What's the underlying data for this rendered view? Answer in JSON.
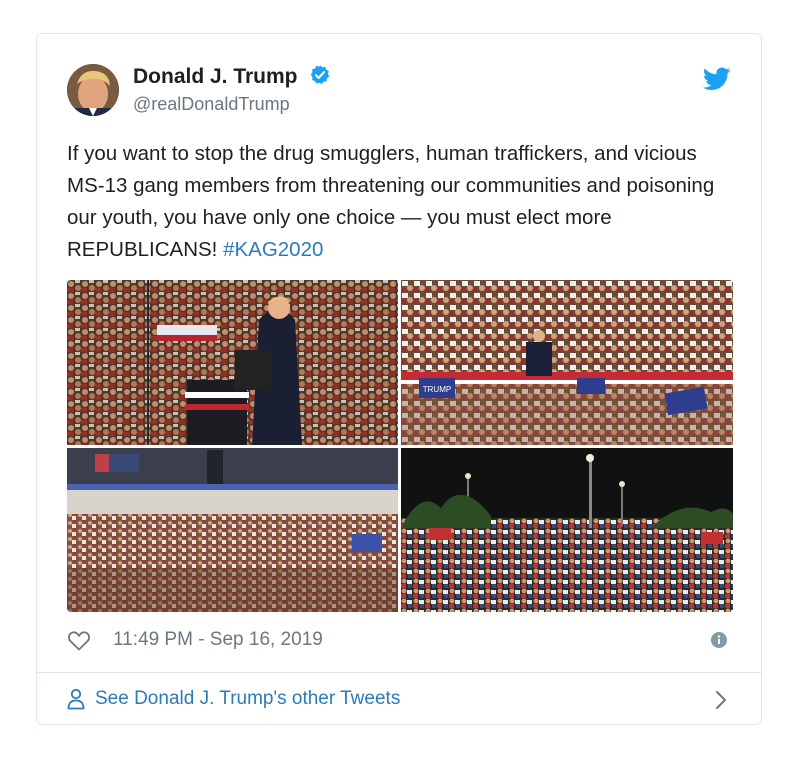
{
  "tweet": {
    "author_name": "Donald J. Trump",
    "author_handle": "@realDonaldTrump",
    "text": "If you want to stop the drug smugglers, human traffickers, and vicious MS-13 gang members from threatening our communities and poisoning our youth, you have only one choice — you must elect more REPUBLICANS! ",
    "hashtag": "#KAG2020",
    "timestamp": "11:49 PM - Sep 16, 2019"
  },
  "media": {
    "sign_text": "TRUMP"
  },
  "footer": {
    "link_text": "See Donald J. Trump's other Tweets"
  },
  "icons": {
    "twitter": "twitter-bird-icon",
    "verified": "verified-badge-icon",
    "like": "heart-icon",
    "info": "info-icon",
    "person": "person-icon",
    "chevron": "chevron-right-icon"
  },
  "colors": {
    "link": "#2b7bb9",
    "verified": "#1da1f2",
    "muted": "#697882",
    "border": "#e1e8ed"
  }
}
